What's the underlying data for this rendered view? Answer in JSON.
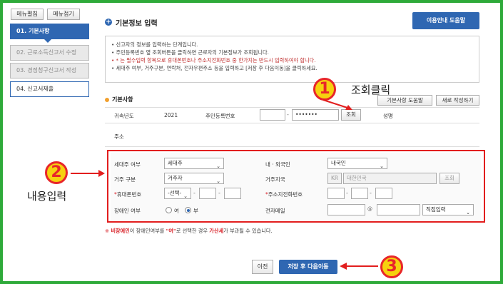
{
  "nav": {
    "expand_label": "메뉴펼침",
    "collapse_label": "메뉴접기",
    "items": [
      {
        "label": "01. 기본사항"
      },
      {
        "label": "02. 근로소득신고서 수정"
      },
      {
        "label": "03. 경정청구신고서 작성"
      },
      {
        "label": "04. 신고서제출"
      }
    ]
  },
  "header": {
    "title": "기본정보 입력",
    "help_button": "이용안내 도움말"
  },
  "info": [
    "• 신고자의 정보를 입력하는 단계입니다.",
    "• 주민등록번호 옆 조회버튼을 클릭하면 근로자의 기본정보가 조회됩니다.",
    "• * 는 필수입력 항목으로 휴대폰번호나 주소지전화번호 중 한가지는 반드시 입력하여야 합니다.",
    "• 세대주 여부, 거주구분, 연락처, 전자우편주소 등을 입력하고 [저장 후 다음이동]을 클릭하세요."
  ],
  "basic": {
    "title": "기본사항",
    "help_btn": "기본사항 도움말",
    "new_btn": "새로 작성하기",
    "year_label": "귀속년도",
    "year_value": "2021",
    "ssn_label": "주민등록번호",
    "ssn_front": "",
    "ssn_back": "•••••••",
    "lookup_btn": "조회",
    "name_label": "성명",
    "address_label": "주소"
  },
  "form": {
    "householder_label": "세대주 여부",
    "householder_value": "세대주",
    "nationality_label": "내 · 외국인",
    "nationality_value": "내국인",
    "residence_label": "거주 구분",
    "residence_value": "거주자",
    "country_label": "거주지국",
    "country_code": "KR",
    "country_name": "대한민국",
    "country_btn": "조회",
    "mobile_label": "휴대폰번호",
    "mobile_select": "-선택-",
    "phone_label": "주소지전화번호",
    "disabled_label": "장애인 여부",
    "disabled_yes": "여",
    "disabled_no": "부",
    "disabled_selected": "부",
    "email_label": "전자메일",
    "email_at": "@",
    "email_domain": "직접입력",
    "req_mark": "*"
  },
  "note": {
    "prefix": "※ ",
    "bold1": "비장애인",
    "mid1": "이 장애인여부를 ",
    "bold2": "\"여\"",
    "mid2": "로 선택한 경우 ",
    "bold3": "가산세",
    "end": "가 부과될 수 있습니다."
  },
  "footer": {
    "prev": "이전",
    "next": "저장 후 다음이동"
  },
  "annotations": {
    "n1": "1",
    "n2": "2",
    "n3": "3",
    "lookup_click": "조회클릭",
    "content_input": "내용입력"
  },
  "colors": {
    "accent": "#2f67b2",
    "frame": "#2eaa3a",
    "annotation_red": "#e21e1e",
    "badge_yellow": "#f6d10f"
  }
}
